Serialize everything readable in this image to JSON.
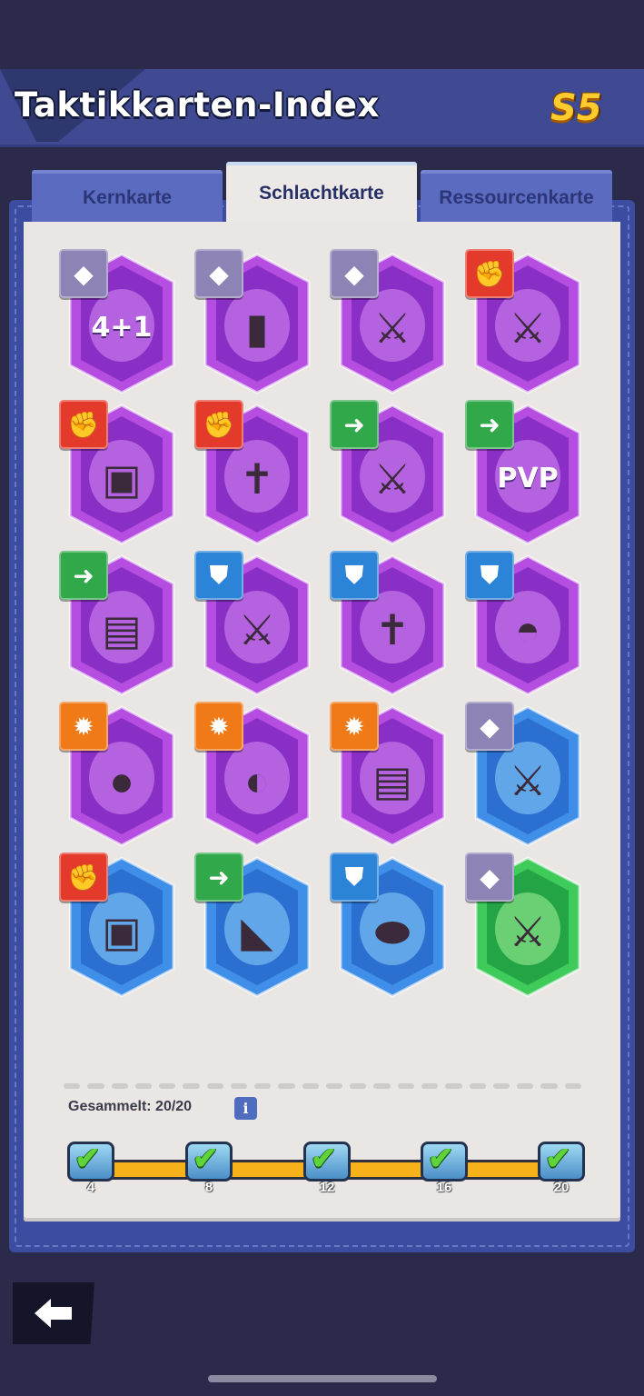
{
  "header": {
    "title": "Taktikkarten-Index",
    "season": "S5"
  },
  "tabs": [
    {
      "label": "Kernkarte",
      "active": false
    },
    {
      "label": "Schlachtkarte",
      "active": true
    },
    {
      "label": "Ressourcenkarte",
      "active": false
    }
  ],
  "cards": [
    {
      "badge": "gray",
      "badge_icon": "diamond-icon",
      "frame": "purple",
      "art": "4+1",
      "art_icon": "upgrade-arrow-icon"
    },
    {
      "badge": "gray",
      "badge_icon": "diamond-icon",
      "frame": "purple",
      "art": "",
      "art_icon": "bullet-icon"
    },
    {
      "badge": "gray",
      "badge_icon": "diamond-icon",
      "frame": "purple",
      "art": "",
      "art_icon": "zombie-rifles-icon"
    },
    {
      "badge": "red",
      "badge_icon": "fist-icon",
      "frame": "purple",
      "art": "",
      "art_icon": "rifles-rocket-icon"
    },
    {
      "badge": "red",
      "badge_icon": "fist-icon",
      "frame": "purple",
      "art": "",
      "art_icon": "cracked-block-icon"
    },
    {
      "badge": "red",
      "badge_icon": "fist-icon",
      "frame": "purple",
      "art": "",
      "art_icon": "gravestone-icon"
    },
    {
      "badge": "green",
      "badge_icon": "boot-arrow-icon",
      "frame": "purple",
      "art": "",
      "art_icon": "rifles-tire-icon"
    },
    {
      "badge": "green",
      "badge_icon": "boot-arrow-icon",
      "frame": "purple",
      "art": "PVP",
      "art_icon": "boot-icon"
    },
    {
      "badge": "green",
      "badge_icon": "boot-arrow-icon",
      "frame": "purple",
      "art": "",
      "art_icon": "building-icon"
    },
    {
      "badge": "blue",
      "badge_icon": "shield-icon",
      "frame": "purple",
      "art": "",
      "art_icon": "rifles-wall-icon"
    },
    {
      "badge": "blue",
      "badge_icon": "shield-icon",
      "frame": "purple",
      "art": "",
      "art_icon": "gravestone-wall-icon"
    },
    {
      "badge": "blue",
      "badge_icon": "shield-icon",
      "frame": "purple",
      "art": "",
      "art_icon": "helmet-icon"
    },
    {
      "badge": "orange",
      "badge_icon": "bomb-star-icon",
      "frame": "purple",
      "art": "",
      "art_icon": "bomb-icon"
    },
    {
      "badge": "orange",
      "badge_icon": "bomb-star-icon",
      "frame": "purple",
      "art": "",
      "art_icon": "bomb-crater-icon"
    },
    {
      "badge": "orange",
      "badge_icon": "bomb-star-icon",
      "frame": "purple",
      "art": "",
      "art_icon": "bomb-building-icon"
    },
    {
      "badge": "gray",
      "badge_icon": "diamond-icon",
      "frame": "blue",
      "art": "",
      "art_icon": "zombie-rifles-icon"
    },
    {
      "badge": "red",
      "badge_icon": "fist-icon",
      "frame": "blue",
      "art": "",
      "art_icon": "cracked-block-icon"
    },
    {
      "badge": "green",
      "badge_icon": "boot-arrow-icon",
      "frame": "blue",
      "art": "",
      "art_icon": "boot-icon"
    },
    {
      "badge": "blue",
      "badge_icon": "shield-icon",
      "frame": "blue",
      "art": "",
      "art_icon": "pills-icon"
    },
    {
      "badge": "gray",
      "badge_icon": "diamond-icon",
      "frame": "green",
      "art": "",
      "art_icon": "zombie-rifles-icon"
    }
  ],
  "progress": {
    "label": "Gesammelt: 20/20",
    "collected": 20,
    "total": 20,
    "info_icon": "info-icon",
    "milestones": [
      {
        "value": "4",
        "claimed": true
      },
      {
        "value": "8",
        "claimed": true
      },
      {
        "value": "12",
        "claimed": true
      },
      {
        "value": "16",
        "claimed": true
      },
      {
        "value": "20",
        "claimed": true
      }
    ]
  },
  "colors": {
    "header_bg": "#3f4a93",
    "frame_purple": "#b64ce3",
    "frame_blue": "#3a8ee6",
    "frame_green": "#3ecb5a",
    "progress_fill": "#f7b21b"
  }
}
